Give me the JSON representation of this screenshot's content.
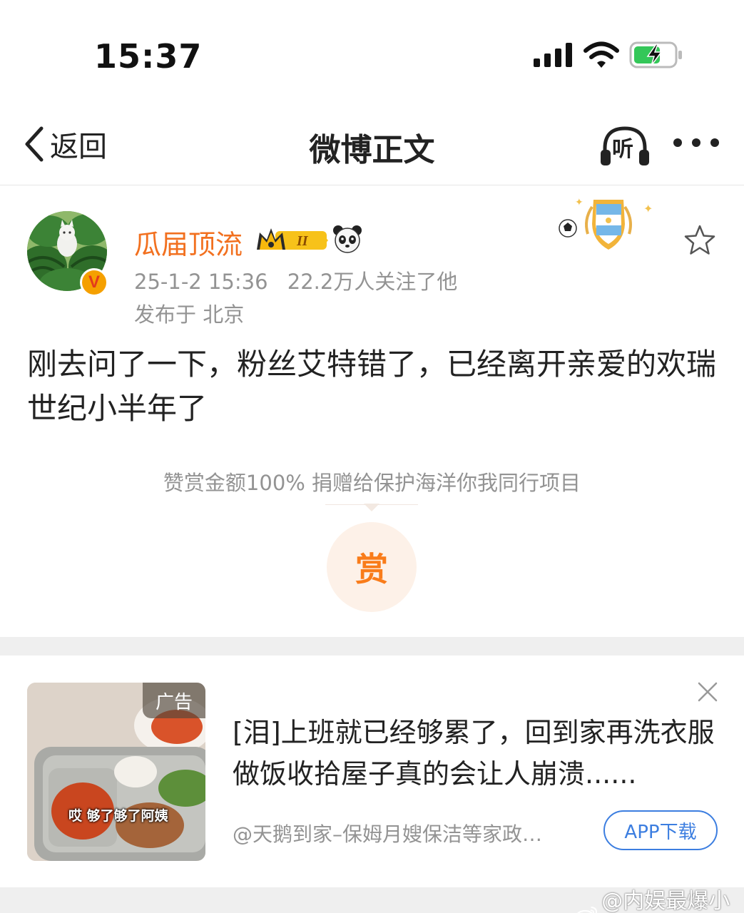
{
  "status_bar": {
    "time": "15:37"
  },
  "nav": {
    "back_label": "返回",
    "title": "微博正文",
    "listen_label": "听"
  },
  "post": {
    "username": "瓜届顶流",
    "level_badge": "II",
    "verified_mark": "V",
    "timestamp": "25-1-2 15:36",
    "followers": "22.2万人关注了他",
    "location": "发布于 北京",
    "body": "刚去问了一下，粉丝艾特错了，已经离开亲爱的欢瑞世纪小半年了"
  },
  "reward": {
    "note": "赞赏金额100% 捐赠给保护海洋你我同行项目",
    "button_label": "赏"
  },
  "ad": {
    "label": "广告",
    "caption": "哎 够了够了阿姨",
    "text": "[泪]上班就已经够累了，回到家再洗衣服做饭收拾屋子真的会让人崩溃......",
    "source": "@天鹅到家–保姆月嫂保洁等家政…",
    "download_label": "APP下载"
  },
  "watermark": {
    "text": "@内娱最爆小胖橘"
  },
  "colors": {
    "username": "#f2701f",
    "reward_accent": "#f97c1a",
    "link_blue": "#3c7ee0",
    "muted_text": "#939393"
  }
}
